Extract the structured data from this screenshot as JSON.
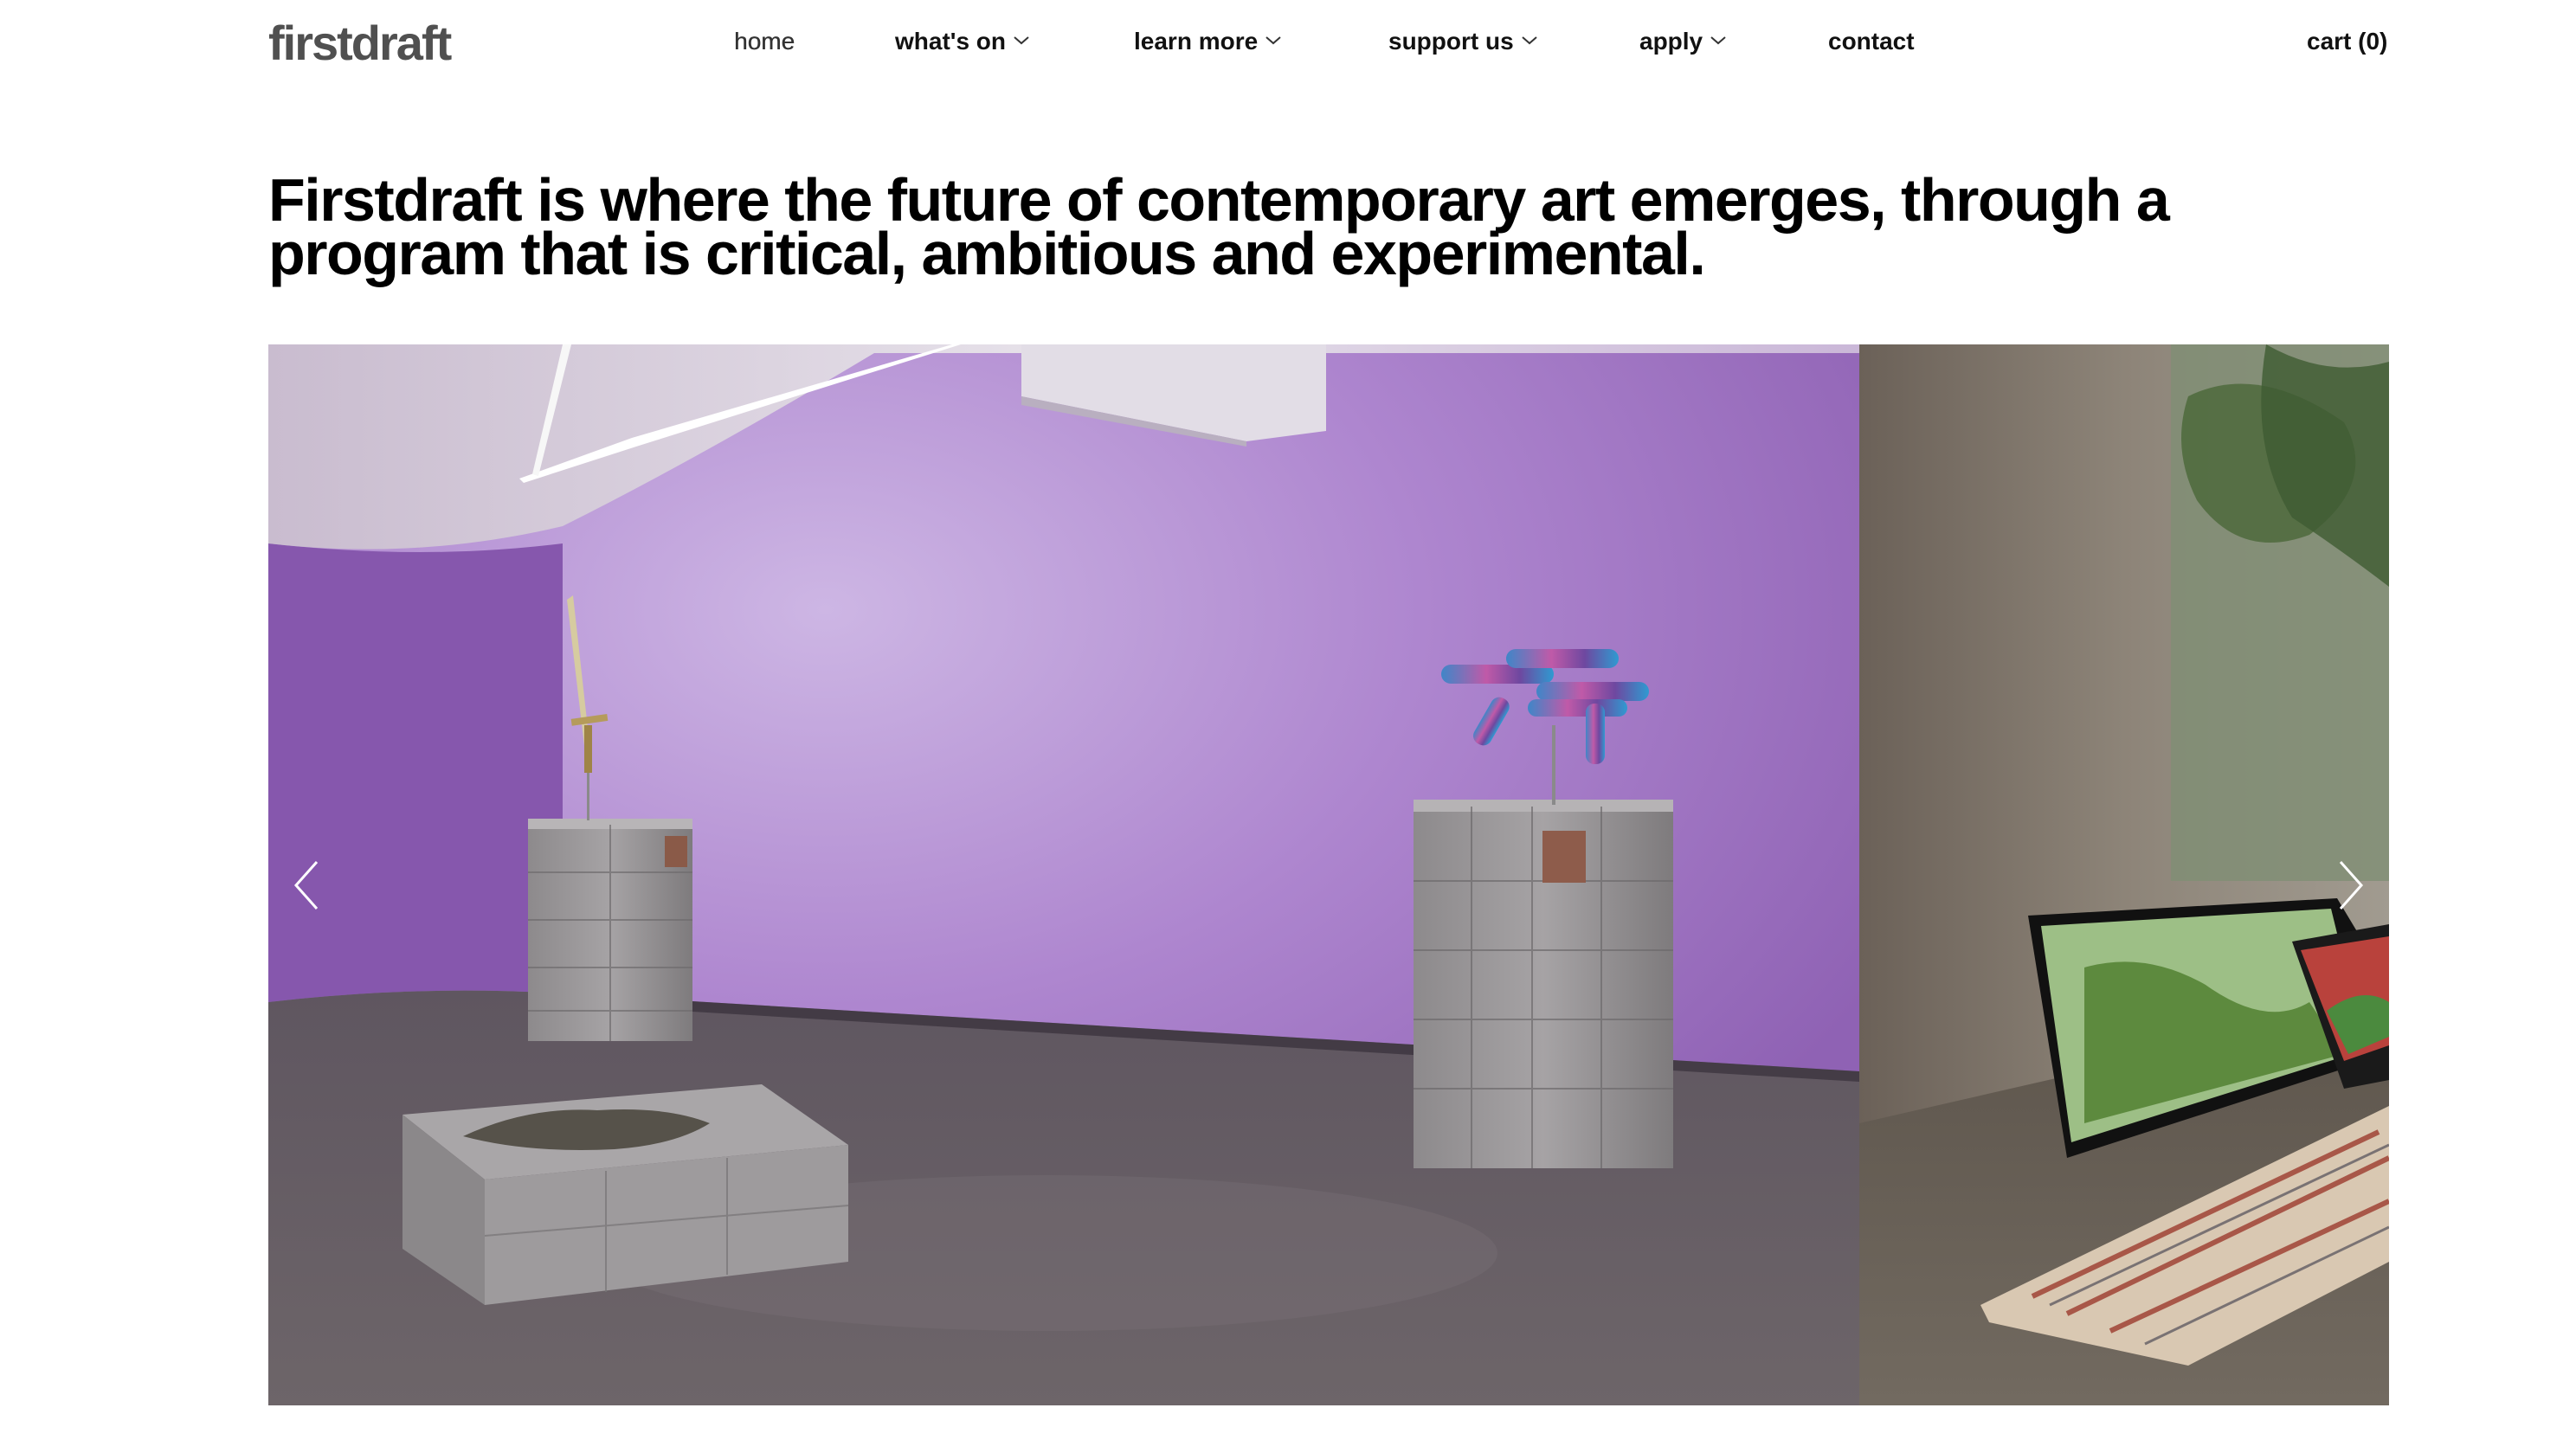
{
  "header": {
    "logo": "firstdraft",
    "nav": [
      {
        "label": "home",
        "dropdown": false
      },
      {
        "label": "what's on",
        "dropdown": true
      },
      {
        "label": "learn more",
        "dropdown": true
      },
      {
        "label": "support us",
        "dropdown": true
      },
      {
        "label": "apply",
        "dropdown": true
      },
      {
        "label": "contact",
        "dropdown": false
      }
    ],
    "cart": "cart (0)"
  },
  "hero": {
    "tagline": "Firstdraft is where the future of contemporary art emerges, through a program that is critical, ambitious and experimental."
  },
  "carousel": {
    "prev_icon": "chevron-left-icon",
    "next_icon": "chevron-right-icon",
    "slides": [
      {
        "description_icon": "gallery-installation-photo-purple-room"
      },
      {
        "description_icon": "gallery-installation-photo-video-screens"
      }
    ]
  },
  "colors": {
    "logo": "#505050",
    "wall_purple": "#a77fc6",
    "floor": "#6b6468"
  }
}
